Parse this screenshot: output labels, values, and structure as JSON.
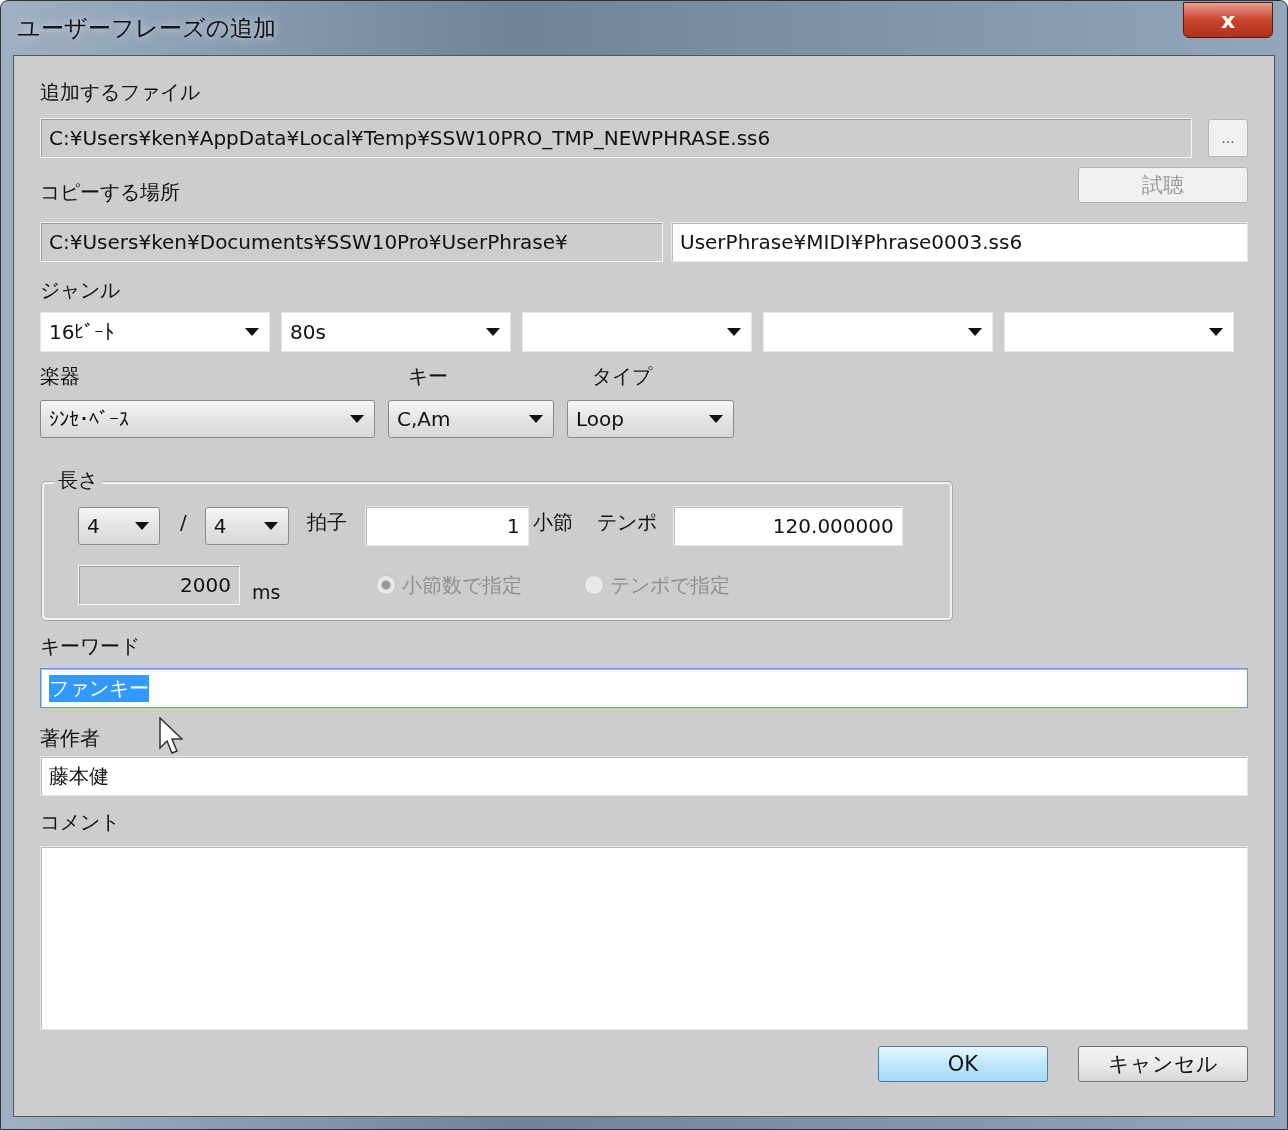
{
  "window": {
    "title": "ユーザーフレーズの追加",
    "close": "x"
  },
  "file": {
    "label": "追加するファイル",
    "value": "C:¥Users¥ken¥AppData¥Local¥Temp¥SSW10PRO_TMP_NEWPHRASE.ss6",
    "browse": "..."
  },
  "copy": {
    "label": "コピーする場所",
    "preview": {
      "label": "試聴",
      "disabled": true
    },
    "base": "C:¥Users¥ken¥Documents¥SSW10Pro¥UserPhrase¥",
    "path": "UserPhrase¥MIDI¥Phrase0003.ss6"
  },
  "genre": {
    "label": "ジャンル",
    "dropdowns": [
      {
        "kind": "filled",
        "value": "16ﾋﾞｰﾄ"
      },
      {
        "kind": "filled",
        "value": "80s"
      },
      {
        "kind": "blank"
      },
      {
        "kind": "blank"
      },
      {
        "kind": "blank"
      }
    ]
  },
  "instrument": {
    "label": "楽器",
    "value": "ｼﾝｾ･ﾍﾞｰｽ"
  },
  "key": {
    "label": "キー",
    "value": "C,Am"
  },
  "type": {
    "label": "タイプ",
    "value": "Loop"
  },
  "length": {
    "legend": "長さ",
    "numerator": "4",
    "slash": "/",
    "denominator": "4",
    "meter_label": "拍子",
    "bars": "1",
    "bars_label": "小節",
    "tempo_label": "テンポ",
    "tempo": "120.000000",
    "ms": "2000",
    "ms_label": "ms",
    "modes": [
      {
        "label": "小節数で指定",
        "selected": true,
        "disabled": true
      },
      {
        "label": "テンポで指定",
        "selected": false,
        "disabled": true
      }
    ]
  },
  "keyword": {
    "label": "キーワード",
    "value": "ファンキー",
    "focused": true
  },
  "author": {
    "label": "著作者",
    "value": "藤本健"
  },
  "comment": {
    "label": "コメント"
  },
  "buttons": [
    {
      "label": "OK",
      "default": true
    },
    {
      "label": "キャンセル",
      "default": false
    }
  ]
}
